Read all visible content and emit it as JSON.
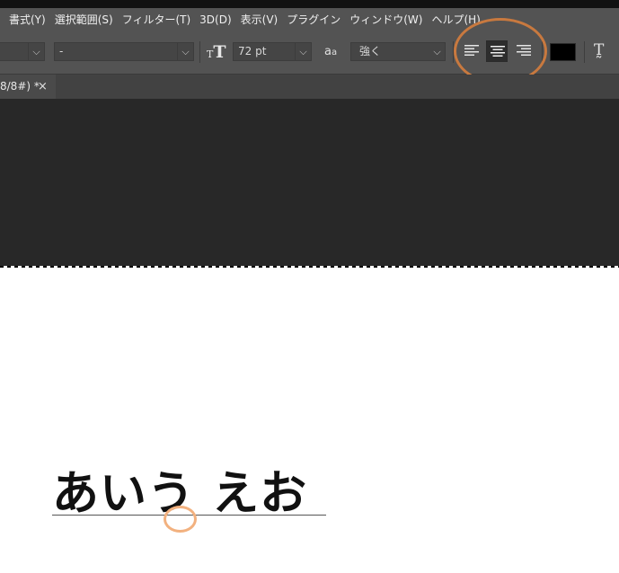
{
  "menubar": {
    "items": [
      "書式(Y)",
      "選択範囲(S)",
      "フィルター(T)",
      "3D(D)",
      "表示(V)",
      "プラグイン",
      "ウィンドウ(W)",
      "ヘルプ(H)"
    ]
  },
  "options_bar": {
    "font_style_value": "-",
    "font_size_value": "72 pt",
    "antialias_value": "強く",
    "alignment_selected": "center",
    "text_color": "#000000"
  },
  "tab": {
    "title": "8/8#) *",
    "close_glyph": "×"
  },
  "canvas": {
    "text": "あいう えお"
  },
  "colors": {
    "ui_background": "#535353",
    "workspace": "#282828",
    "highlight_annotation": "#c8793f",
    "cursor_annotation": "#f2b17f"
  }
}
